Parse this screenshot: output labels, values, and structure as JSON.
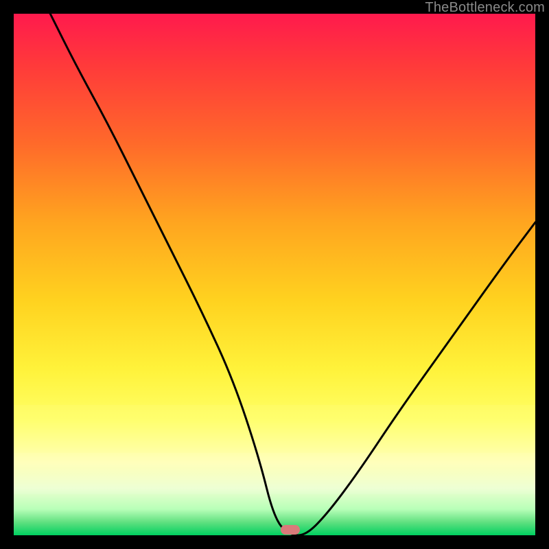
{
  "watermark": "TheBottleneck.com",
  "marker": {
    "x_pct": 53,
    "y_pct": 99
  },
  "chart_data": {
    "type": "line",
    "title": "",
    "xlabel": "",
    "ylabel": "",
    "xlim": [
      0,
      100
    ],
    "ylim": [
      0,
      100
    ],
    "grid": false,
    "legend": false,
    "series": [
      {
        "name": "bottleneck-curve",
        "x": [
          7,
          12,
          18,
          24,
          30,
          36,
          42,
          47,
          50,
          53,
          56,
          60,
          66,
          74,
          84,
          94,
          100
        ],
        "y": [
          100,
          90,
          79,
          67,
          55,
          43,
          30,
          15,
          3,
          0,
          0,
          4,
          12,
          24,
          38,
          52,
          60
        ]
      }
    ],
    "gradient_stops": [
      {
        "pct": 0,
        "color": "#ff1a4d"
      },
      {
        "pct": 10,
        "color": "#ff3a3a"
      },
      {
        "pct": 25,
        "color": "#ff6a2a"
      },
      {
        "pct": 40,
        "color": "#ffa51f"
      },
      {
        "pct": 55,
        "color": "#ffd21f"
      },
      {
        "pct": 68,
        "color": "#fff23a"
      },
      {
        "pct": 78,
        "color": "#ffff66"
      },
      {
        "pct": 86,
        "color": "#ffffb0"
      },
      {
        "pct": 91,
        "color": "#ecffd0"
      },
      {
        "pct": 95,
        "color": "#b8ffb8"
      },
      {
        "pct": 97.5,
        "color": "#60e080"
      },
      {
        "pct": 100,
        "color": "#00d060"
      }
    ]
  }
}
